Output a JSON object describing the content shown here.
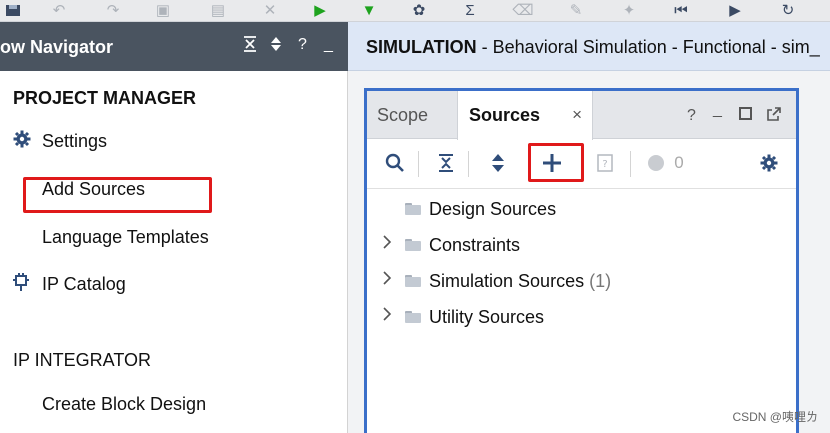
{
  "toolbar": {
    "icons": [
      "save-icon",
      "undo-icon",
      "redo-icon",
      "copy-icon",
      "paste-icon",
      "delete-icon",
      "run-icon",
      "run-for-icon",
      "settings-icon",
      "sigma-icon",
      "clear-icon",
      "marker-icon",
      "pin-icon",
      "restart-icon",
      "run-all-icon",
      "relaunch-icon"
    ]
  },
  "navigator": {
    "title": "ow Navigator",
    "sections": {
      "project_manager": "PROJECT MANAGER",
      "ip_integrator": "IP INTEGRATOR"
    },
    "items": {
      "settings": "Settings",
      "add_sources": "Add Sources",
      "language_templates": "Language Templates",
      "ip_catalog": "IP Catalog",
      "create_block_design": "Create Block Design"
    },
    "tool_icons": [
      "collapse-all-icon",
      "expand-icon",
      "help-icon",
      "minimize-icon"
    ]
  },
  "simulation": {
    "label": "SIMULATION",
    "subtitle": " - Behavioral Simulation - Functional - sim_"
  },
  "sources_panel": {
    "tabs": {
      "scope": "Scope",
      "sources": "Sources",
      "close": "×"
    },
    "controls": {
      "help": "?",
      "minimize": "_",
      "maximize": "□",
      "float": "↗"
    },
    "toolbar": {
      "status_count": "0"
    },
    "tree": [
      {
        "label": "Design Sources",
        "count": "",
        "expandable": false
      },
      {
        "label": "Constraints",
        "count": "",
        "expandable": true
      },
      {
        "label": "Simulation Sources",
        "count": "(1)",
        "expandable": true
      },
      {
        "label": "Utility Sources",
        "count": "",
        "expandable": true
      }
    ]
  },
  "colors": {
    "nav_header": "#4a5460",
    "sim_header": "#dde7f6",
    "highlight": "#e0191a",
    "panel_border": "#3b6fc9"
  },
  "watermark": "CSDN @咦哩ㄌ"
}
